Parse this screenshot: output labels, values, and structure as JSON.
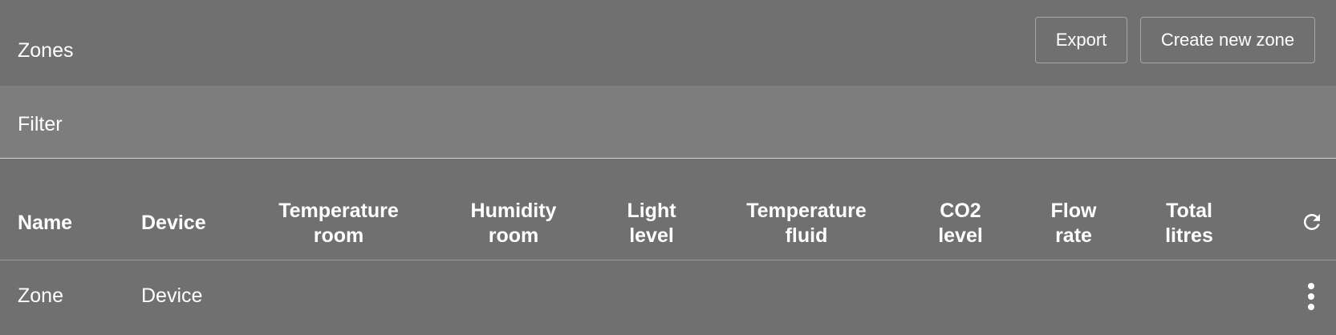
{
  "header": {
    "title": "Zones",
    "export_label": "Export",
    "create_label": "Create new zone"
  },
  "filter": {
    "label": "Filter"
  },
  "table": {
    "columns": [
      {
        "line1": "Name",
        "line2": ""
      },
      {
        "line1": "Device",
        "line2": ""
      },
      {
        "line1": "Temperature",
        "line2": "room"
      },
      {
        "line1": "Humidity",
        "line2": "room"
      },
      {
        "line1": "Light",
        "line2": "level"
      },
      {
        "line1": "Temperature",
        "line2": "fluid"
      },
      {
        "line1": "CO2",
        "line2": "level"
      },
      {
        "line1": "Flow",
        "line2": "rate"
      },
      {
        "line1": "Total",
        "line2": "litres"
      }
    ],
    "rows": [
      {
        "name": "Zone",
        "device": "Device"
      }
    ]
  },
  "icons": {
    "refresh": "refresh-icon",
    "row_menu": "more-vert-icon"
  },
  "colors": {
    "background": "#707070",
    "filter_background": "#7d7d7d",
    "text": "#ffffff"
  }
}
